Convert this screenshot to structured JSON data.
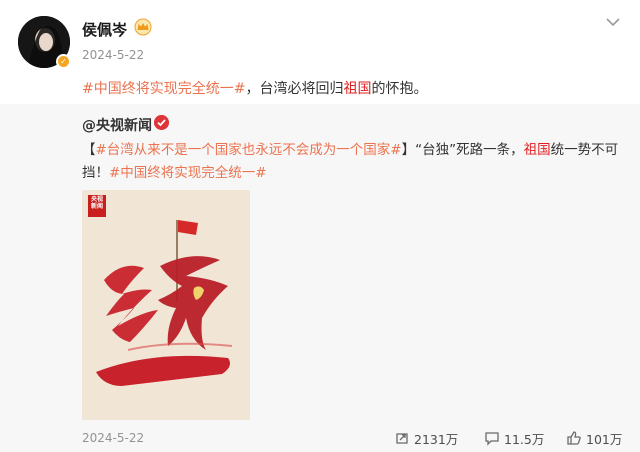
{
  "author": {
    "name": "侯佩岑",
    "date": "2024-5-22",
    "avatar_icon": "avatar-photo",
    "badge_icon": "crown-icon"
  },
  "post": {
    "hashtag": "#中国终将实现完全统一#",
    "text_before": "，台湾必将回归",
    "highlight": "祖国",
    "text_after": "的怀抱。"
  },
  "repost": {
    "author": "@央视新闻",
    "verified_icon": "verified-icon",
    "bracket_open": "【",
    "hashtag1": "#台湾从来不是一个国家也永远不会成为一个国家#",
    "bracket_close": "】",
    "text_a": "“台独”死路一条，",
    "highlight": "祖国",
    "text_b": "统一势不可挡！",
    "hashtag2": "#中国终将实现完全统一#",
    "poster": {
      "logo_lines": [
        "央视",
        "新闻"
      ],
      "calligraphy": "统一"
    }
  },
  "footer": {
    "date": "2024-5-22",
    "reposts": "2131万",
    "comments": "11.5万",
    "likes": "101万"
  },
  "colors": {
    "hashtag": "#eb7350",
    "highlight": "#e02020",
    "repost_bg": "#f7f7f7",
    "poster_bg": "#f1e6d6",
    "calligraphy_red": "#c8232c"
  }
}
